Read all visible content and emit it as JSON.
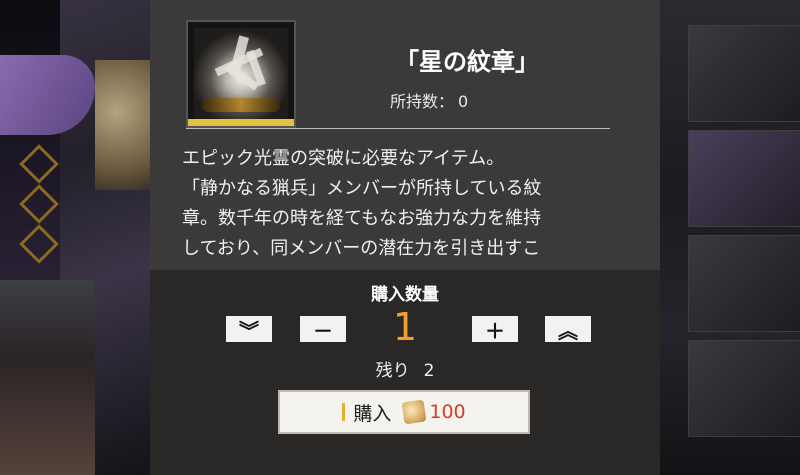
{
  "item": {
    "name": "「星の紋章」",
    "owned_label": "所持数：",
    "owned_count": "0",
    "icon": "star-crest-icon",
    "rarity_color": "#e4c23d"
  },
  "description": [
    "エピック光霊の突破に必要なアイテム。",
    "「静かなる猟兵」メンバーが所持している紋",
    "章。数千年の時を経てもなお強力な力を維持",
    "しており、同メンバーの潜在力を引き出すこ"
  ],
  "quantity": {
    "title": "購入数量",
    "min_symbol": "︾",
    "dec_symbol": "－",
    "value": "1",
    "inc_symbol": "＋",
    "max_symbol": "︽",
    "remaining_label": "残り",
    "remaining_value": "2",
    "value_color": "#f0a030"
  },
  "purchase": {
    "label": "購入",
    "currency_icon": "coin-icon",
    "price": "100",
    "price_color": "#d83a2b"
  }
}
